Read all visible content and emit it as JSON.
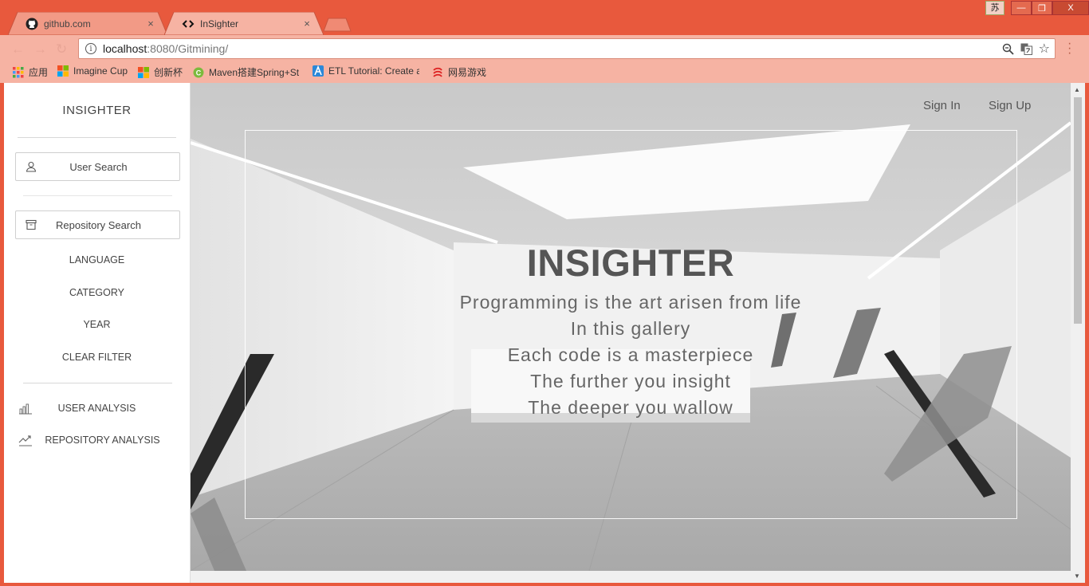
{
  "browser": {
    "tabs": [
      {
        "title": "github.com",
        "active": false
      },
      {
        "title": "InSighter",
        "active": true
      }
    ],
    "tab_close_glyph": "×",
    "ime_indicator": "苏",
    "window_controls": [
      "minimize",
      "restore",
      "close"
    ],
    "address": {
      "host": "localhost",
      "path": ":8080/Gitmining/"
    },
    "bookmarks": [
      {
        "label": "应用",
        "icon": "apps-grid-icon"
      },
      {
        "label": "Imagine Cup",
        "icon": "microsoft-logo-icon"
      },
      {
        "label": "创新杯",
        "icon": "microsoft-logo-icon"
      },
      {
        "label": "Maven搭建Spring+St",
        "icon": "csdn-icon"
      },
      {
        "label": "ETL Tutorial: Create a",
        "icon": "azure-icon"
      },
      {
        "label": "网易游戏",
        "icon": "netease-icon"
      }
    ]
  },
  "sidebar": {
    "brand": "INSIGHTER",
    "user_search": "User Search",
    "repo_search": "Repository Search",
    "filters": [
      "LANGUAGE",
      "CATEGORY",
      "YEAR",
      "CLEAR FILTER"
    ],
    "user_analysis": "USER ANALYSIS",
    "repo_analysis": "REPOSITORY ANALYSIS"
  },
  "hero": {
    "sign_in": "Sign In",
    "sign_up": "Sign Up",
    "title": "INSIGHTER",
    "lines": [
      "Programming is the art arisen from life",
      "In this gallery",
      "Each code is a masterpiece",
      "The further you insight",
      "The deeper you wallow"
    ]
  },
  "colors": {
    "chrome_frame": "#e8593d",
    "toolbar": "#f6b3a3",
    "hero_text": "#555555"
  }
}
